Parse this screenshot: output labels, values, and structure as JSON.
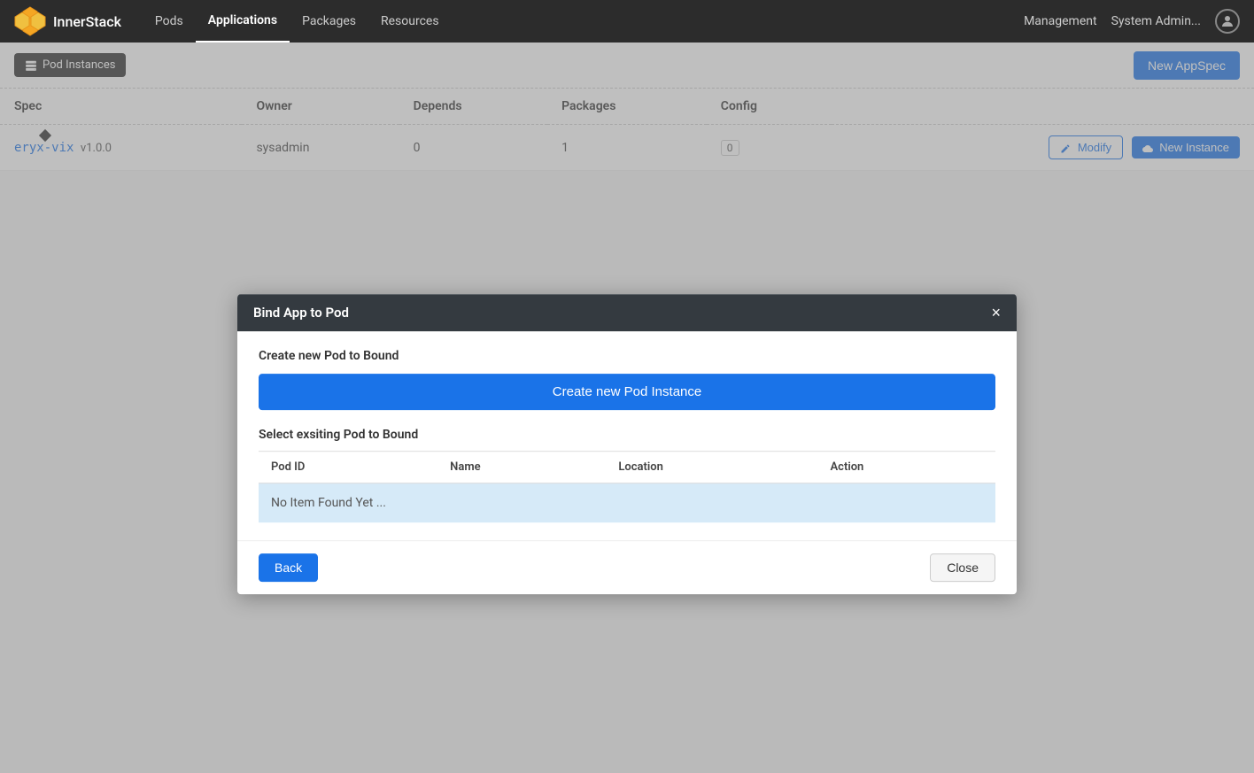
{
  "navbar": {
    "brand": "InnerStack",
    "links": [
      {
        "label": "Pods",
        "active": false
      },
      {
        "label": "Applications",
        "active": true
      },
      {
        "label": "Packages",
        "active": false
      },
      {
        "label": "Resources",
        "active": false
      }
    ],
    "management": "Management",
    "sysadmin": "System Admin...",
    "colors": {
      "accent": "#1a73e8",
      "nav_bg": "#2c2c2c"
    }
  },
  "subheader": {
    "pod_instances_label": "Pod Instances",
    "new_appspec_label": "New AppSpec"
  },
  "table": {
    "columns": [
      "Spec",
      "Owner",
      "Depends",
      "Packages",
      "Config"
    ],
    "rows": [
      {
        "spec_link": "eryx-vix",
        "spec_version": "v1.0.0",
        "owner": "sysadmin",
        "depends": "0",
        "packages": "1",
        "config": "0"
      }
    ],
    "modify_label": "Modify",
    "new_instance_label": "New Instance"
  },
  "modal": {
    "title": "Bind App to Pod",
    "close_symbol": "×",
    "create_new_label": "Create new Pod to Bound",
    "create_new_btn": "Create new Pod Instance",
    "select_existing_label": "Select exsiting Pod to Bound",
    "pod_table_columns": [
      "Pod ID",
      "Name",
      "Location",
      "Action"
    ],
    "no_items_text": "No Item Found Yet ...",
    "back_label": "Back",
    "close_label": "Close"
  }
}
